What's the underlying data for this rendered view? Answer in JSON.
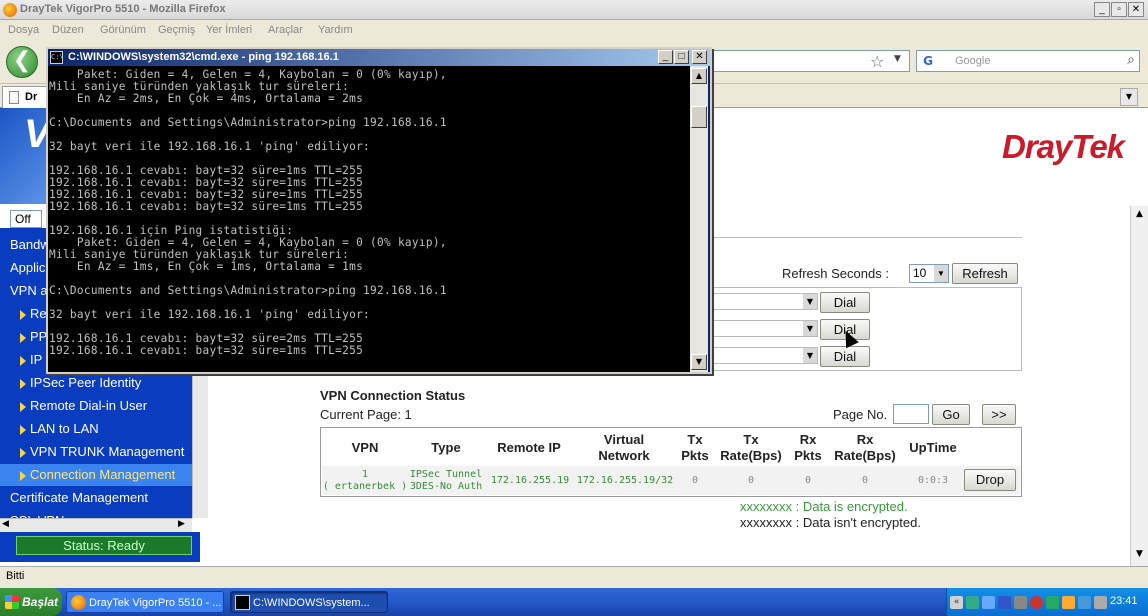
{
  "firefox": {
    "title": "DrayTek VigorPro 5510 - Mozilla Firefox",
    "menu": [
      "Dosya",
      "Düzen",
      "Görünüm",
      "Geçmiş",
      "Yer İmleri",
      "Araçlar",
      "Yardım"
    ],
    "search_placeholder": "Google",
    "tab_label": "Dr",
    "status_text": "Bitti"
  },
  "router": {
    "logo": "DrayTek",
    "off_select": "Off",
    "sidebar": [
      {
        "label": "Bandw",
        "kind": "top"
      },
      {
        "label": "Applic",
        "kind": "top"
      },
      {
        "label": "VPN a",
        "kind": "top"
      },
      {
        "label": "Re",
        "kind": "sub"
      },
      {
        "label": "PP",
        "kind": "sub"
      },
      {
        "label": "IP",
        "kind": "sub"
      },
      {
        "label": "IPSec Peer Identity",
        "kind": "sub"
      },
      {
        "label": "Remote Dial-in User",
        "kind": "sub"
      },
      {
        "label": "LAN to LAN",
        "kind": "sub"
      },
      {
        "label": "VPN TRUNK Management",
        "kind": "sub"
      },
      {
        "label": "Connection Management",
        "kind": "sub",
        "selected": true
      },
      {
        "label": "Certificate Management",
        "kind": "top"
      },
      {
        "label": "SSL VPN",
        "kind": "top"
      }
    ],
    "status_ready": "Status: Ready",
    "refresh_label": "Refresh Seconds :",
    "refresh_value": "10",
    "refresh_button": "Refresh",
    "dial_button": "Dial",
    "vpn_status_title": "VPN Connection Status",
    "current_page": "Current Page: 1",
    "page_no_label": "Page No.",
    "go_button": "Go",
    "next_button": ">>",
    "table": {
      "headers": [
        "VPN",
        "Type",
        "Remote IP",
        "Virtual\nNetwork",
        "Tx\nPkts",
        "Tx\nRate(Bps)",
        "Rx\nPkts",
        "Rx\nRate(Bps)",
        "UpTime"
      ],
      "row": {
        "vpn_index": "1",
        "vpn_name": "( ertanerbek )",
        "type_line1": "IPSec Tunnel",
        "type_line2": "3DES-No Auth",
        "remote_ip": "172.16.255.19",
        "virtual_network": "172.16.255.19/32",
        "tx_pkts": "0",
        "tx_rate": "0",
        "rx_pkts": "0",
        "rx_rate": "0",
        "uptime": "0:0:3",
        "action": "Drop"
      }
    },
    "legend_encrypted_x": "xxxxxxxx",
    "legend_encrypted_text": " : Data is encrypted.",
    "legend_plain_x": "xxxxxxxx",
    "legend_plain_text": " : Data isn't encrypted."
  },
  "cmd": {
    "title": "C:\\WINDOWS\\system32\\cmd.exe - ping 192.168.16.1",
    "output": "    Paket: Giden = 4, Gelen = 4, Kaybolan = 0 (0% kayıp),\nMili saniye türünden yaklaşık tur süreleri:\n    En Az = 2ms, En Çok = 4ms, Ortalama = 2ms\n\nC:\\Documents and Settings\\Administrator>ping 192.168.16.1\n\n32 bayt veri ile 192.168.16.1 'ping' ediliyor:\n\n192.168.16.1 cevabı: bayt=32 süre=1ms TTL=255\n192.168.16.1 cevabı: bayt=32 süre=1ms TTL=255\n192.168.16.1 cevabı: bayt=32 süre=1ms TTL=255\n192.168.16.1 cevabı: bayt=32 süre=1ms TTL=255\n\n192.168.16.1 için Ping istatistiği:\n    Paket: Giden = 4, Gelen = 4, Kaybolan = 0 (0% kayıp),\nMili saniye türünden yaklaşık tur süreleri:\n    En Az = 1ms, En Çok = 1ms, Ortalama = 1ms\n\nC:\\Documents and Settings\\Administrator>ping 192.168.16.1\n\n32 bayt veri ile 192.168.16.1 'ping' ediliyor:\n\n192.168.16.1 cevabı: bayt=32 süre=2ms TTL=255\n192.168.16.1 cevabı: bayt=32 süre=1ms TTL=255"
  },
  "taskbar": {
    "start": "Başlat",
    "task1": "DrayTek VigorPro 5510 - ...",
    "task2": "C:\\WINDOWS\\system...",
    "clock": "23:41"
  }
}
